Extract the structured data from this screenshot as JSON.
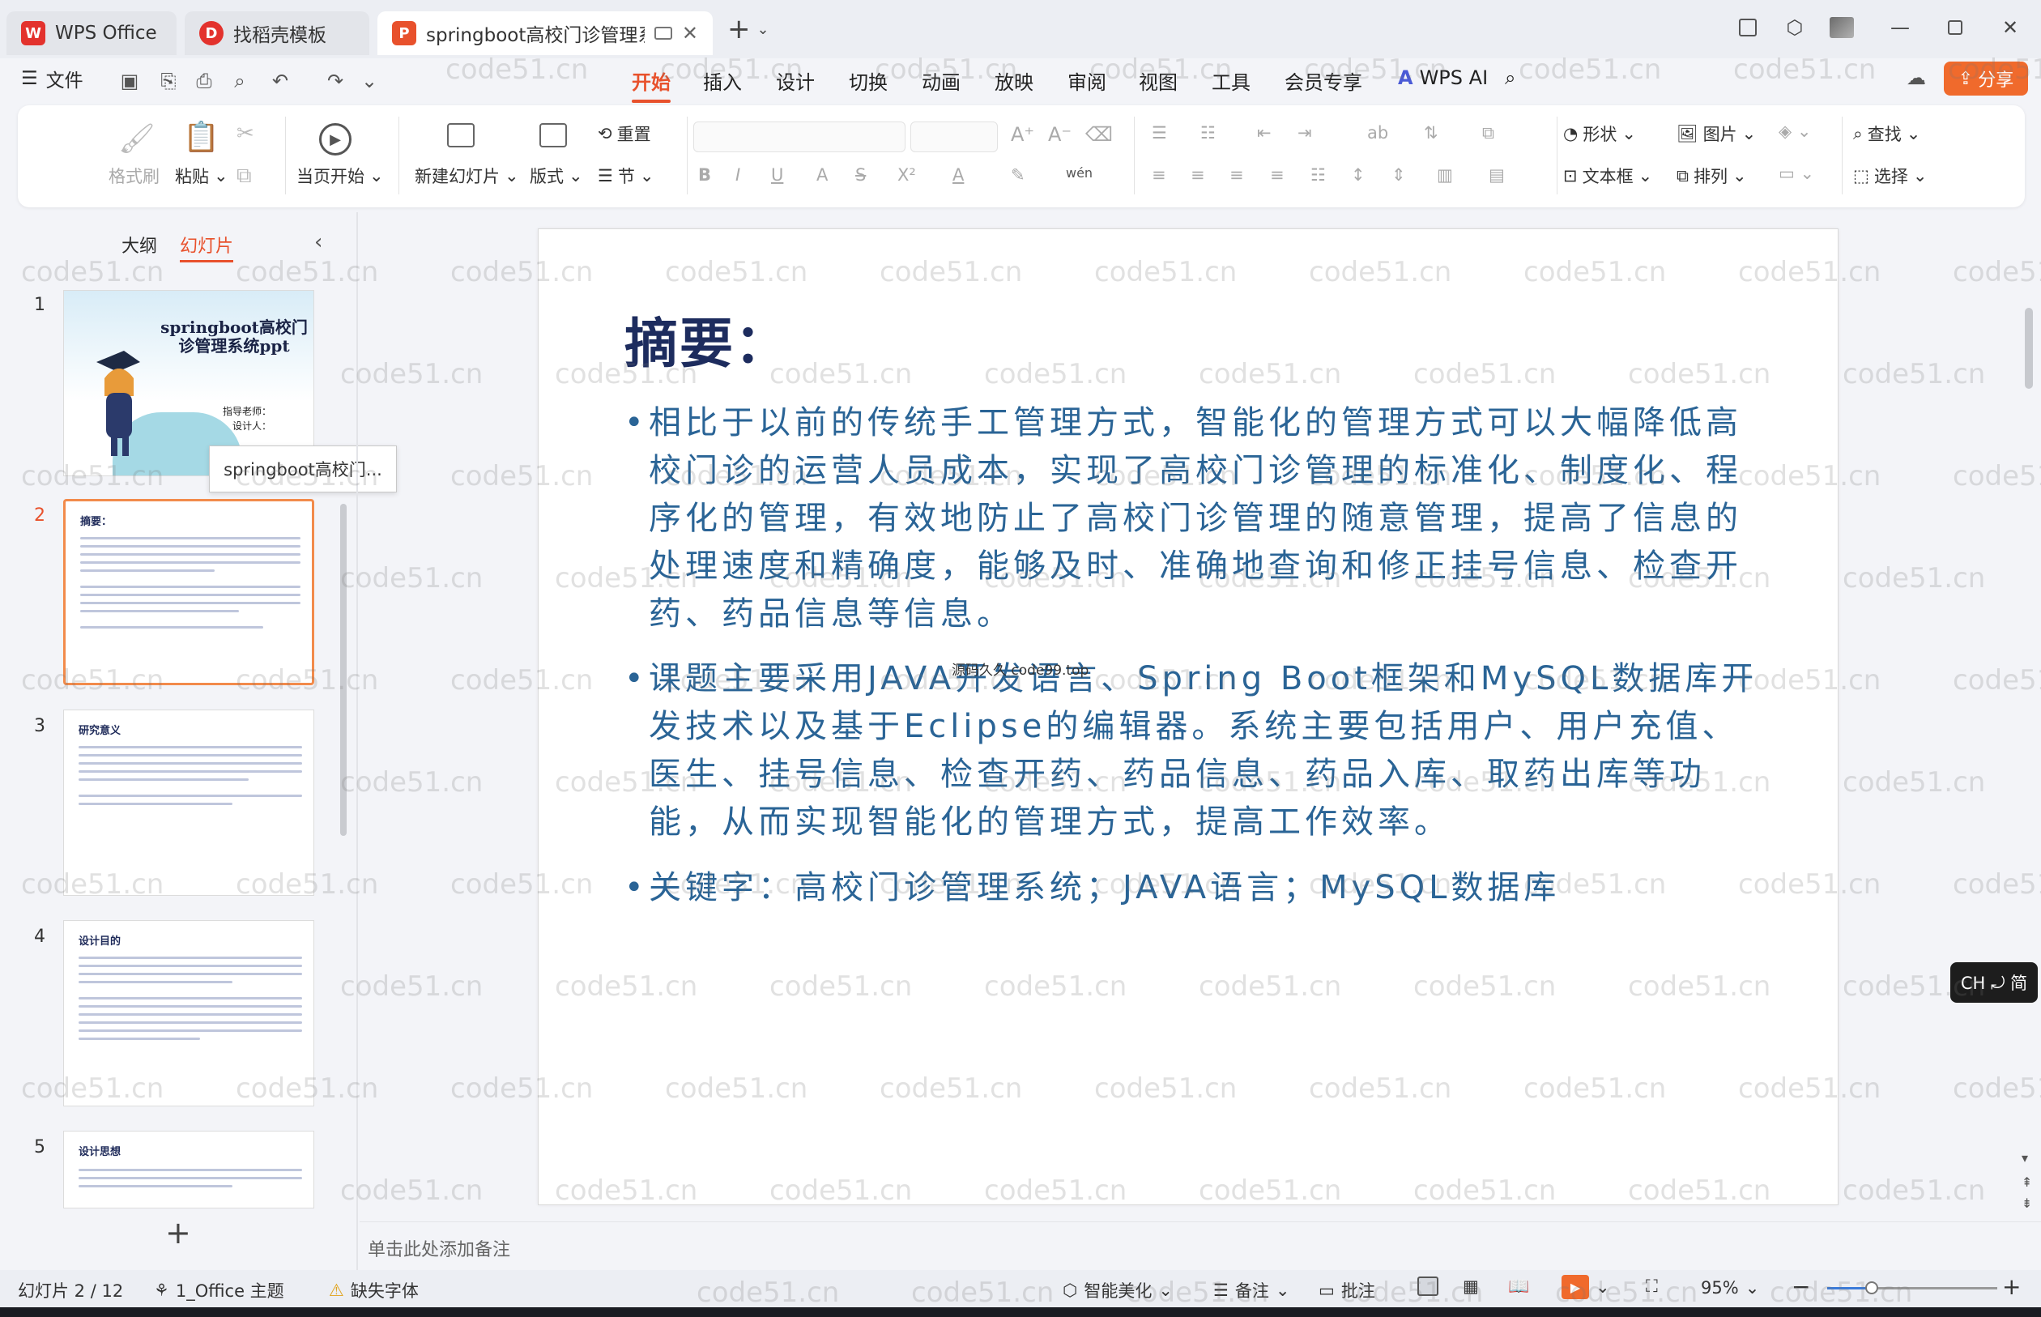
{
  "titlebar": {
    "tabs": [
      {
        "label": "WPS Office",
        "color": "#e3322d"
      },
      {
        "label": "找稻壳模板",
        "color": "#e3322d"
      },
      {
        "label": "springboot高校门诊管理系统",
        "color": "#e8512c"
      }
    ]
  },
  "menu": {
    "file_label": "文件",
    "tabs": [
      "开始",
      "插入",
      "设计",
      "切换",
      "动画",
      "放映",
      "审阅",
      "视图",
      "工具",
      "会员专享"
    ],
    "active_tab": "开始",
    "wps_ai": "WPS AI",
    "share": "分享"
  },
  "ribbon": {
    "format_painter": "格式刷",
    "paste": "粘贴",
    "play_from_current": "当页开始",
    "new_slide": "新建幻灯片",
    "layout": "版式",
    "reset": "重置",
    "section": "节",
    "shape": "形状",
    "picture": "图片",
    "find": "查找",
    "textbox": "文本框",
    "arrange": "排列",
    "select": "选择"
  },
  "panel": {
    "tab_outline": "大纲",
    "tab_slides": "幻灯片",
    "tooltip": "springboot高校门...",
    "slides": [
      {
        "num": "1",
        "title": "springboot高校门诊管理系统ppt",
        "advisor": "指导老师：",
        "designer": "设计人："
      },
      {
        "num": "2",
        "title": "摘要："
      },
      {
        "num": "3",
        "title": "研究意义"
      },
      {
        "num": "4",
        "title": "设计目的"
      },
      {
        "num": "5",
        "title": "设计思想"
      }
    ]
  },
  "slide": {
    "title": "摘要：",
    "bullets": [
      "相比于以前的传统手工管理方式，智能化的管理方式可以大幅降低高校门诊的运营人员成本，实现了高校门诊管理的标准化、制度化、程序化的管理，有效地防止了高校门诊管理的随意管理，提高了信息的处理速度和精确度，能够及时、准确地查询和修正挂号信息、检查开药、药品信息等信息。",
      "课题主要采用JAVA开发语言、Spring Boot框架和MySQL数据库开发技术以及基于Eclipse的编辑器。系统主要包括用户、用户充值、医生、挂号信息、检查开药、药品信息、药品入库、取药出库等功能，从而实现智能化的管理方式，提高工作效率。",
      "关键字：高校门诊管理系统；JAVA语言；MySQL数据库"
    ],
    "overlay_text": "源码久久 code99.top"
  },
  "notes_placeholder": "单击此处添加备注",
  "ime_badge": "CH ⤾ 简",
  "status": {
    "slide_pos": "幻灯片 2 / 12",
    "theme": "1_Office 主题",
    "missing_font": "缺失字体",
    "beautify": "智能美化",
    "notes": "备注",
    "comments": "批注",
    "zoom": "95%",
    "zoom_level": 0.26
  },
  "watermark_text": "code51.cn",
  "colors": {
    "accent": "#e8512c",
    "slide_title": "#1d2c5e",
    "slide_body": "#2a6496"
  }
}
